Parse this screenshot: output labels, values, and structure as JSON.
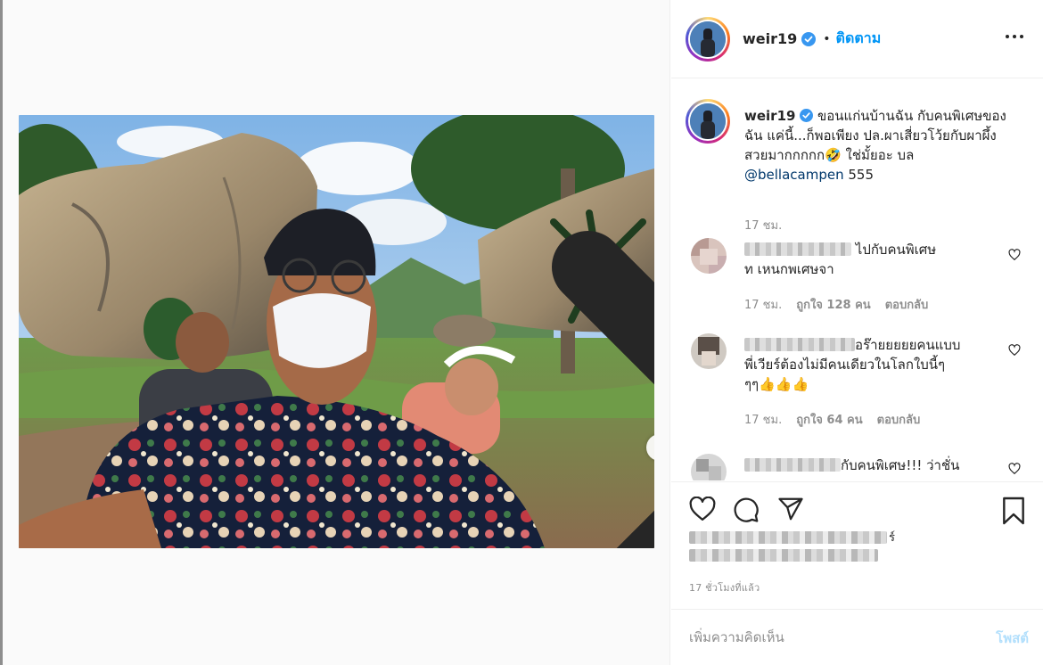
{
  "post": {
    "username": "weir19",
    "follow_label": "ติดตาม",
    "separator": "•",
    "more_icon": "more-horizontal-icon"
  },
  "caption": {
    "username": "weir19",
    "text": "ขอนแก่นบ้านฉัน กับคนพิเศษของฉัน แค่นี้...ก็พอเพียง ปล.ผาเสี่ยวโว้ยกับผาผึ้ง สวยมากกกกก🤣 ใช่มั้ยอะ บล",
    "mention": "@bellacampen",
    "suffix": " 555",
    "time": "17 ชม."
  },
  "comments": [
    {
      "text": "ไปกับคนพิเศษ ท เหนกพเศษจา",
      "text_line1": "ไปกับคนพิเศษ",
      "text_line2": "ท เหนกพเศษจา",
      "time": "17 ชม.",
      "likes": "ถูกใจ 128 คน",
      "reply": "ตอบกลับ"
    },
    {
      "text": "อร๊ายยยยยคนแบบ พี่เวียร์ต้องไม่มีคนเดียวในโลกใบนี้ๆ ๆๆ👍👍👍",
      "text_line1": "อร๊ายยยยยคนแบบ",
      "text_line2": "พี่เวียร์ต้องไม่มีคนเดียวในโลกใบนี้ๆ",
      "text_line3": "ๆๆ👍👍👍",
      "time": "17 ชม.",
      "likes": "ถูกใจ 64 คน",
      "reply": "ตอบกลับ"
    },
    {
      "text": "กับคนพิเศษ!!! ว่าชั่น"
    }
  ],
  "actions": {
    "like_icon": "heart-icon",
    "comment_icon": "comment-icon",
    "share_icon": "paper-plane-icon",
    "save_icon": "bookmark-icon"
  },
  "likes_summary": {
    "suffix": "ร์"
  },
  "post_time": "17 ชั่วโมงที่แล้ว",
  "add_comment": {
    "placeholder": "เพิ่มความคิดเห็น",
    "post_label": "โพสต์"
  },
  "colors": {
    "accent": "#0095f6",
    "verified": "#3897f0",
    "post_disabled": "#b2dffc",
    "secondary_text": "#8e8e8e"
  }
}
